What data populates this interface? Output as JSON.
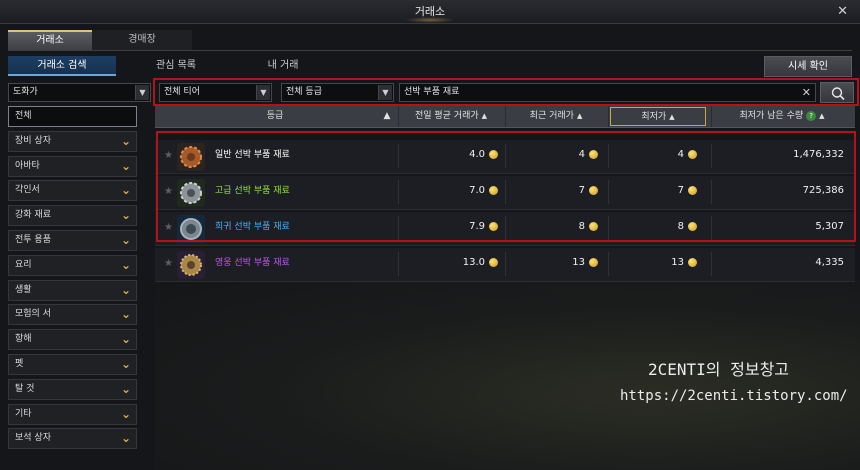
{
  "window": {
    "title": "거래소",
    "close_glyph": "✕"
  },
  "tabs": [
    {
      "label": "거래소"
    },
    {
      "label": "경매장"
    }
  ],
  "subtabs": [
    {
      "label": "거래소 검색"
    },
    {
      "label": "관심 목록"
    },
    {
      "label": "내 거래"
    }
  ],
  "market_button": "시세 확인",
  "filters": {
    "category": "도화가",
    "tier": "전체 티어",
    "grade": "전체 등급",
    "search_value": "선박 부품 재료",
    "clear_glyph": "✕"
  },
  "sidebar": {
    "items": [
      {
        "label": "전체",
        "expandable": false
      },
      {
        "label": "장비 상자",
        "expandable": true
      },
      {
        "label": "아바타",
        "expandable": true
      },
      {
        "label": "각인서",
        "expandable": true
      },
      {
        "label": "강화 재료",
        "expandable": true
      },
      {
        "label": "전투 용품",
        "expandable": true
      },
      {
        "label": "요리",
        "expandable": true
      },
      {
        "label": "생활",
        "expandable": true
      },
      {
        "label": "모험의 서",
        "expandable": true
      },
      {
        "label": "항해",
        "expandable": true
      },
      {
        "label": "펫",
        "expandable": true
      },
      {
        "label": "탈 것",
        "expandable": true
      },
      {
        "label": "기타",
        "expandable": true
      },
      {
        "label": "보석 상자",
        "expandable": true
      }
    ]
  },
  "table": {
    "headers": {
      "grade": "등급",
      "avg_price": "전일 평균 거래가",
      "recent_price": "최근 거래가",
      "lowest_price": "최저가",
      "lowest_qty": "최저가 남은 수량"
    },
    "help_glyph": "?",
    "sort_glyph": "▲",
    "rows": [
      {
        "name": "일반 선박 부품 재료",
        "name_color": "#ffffff",
        "avg": "4.0",
        "recent": "4",
        "lowest": "4",
        "qty": "1,476,332",
        "icon": "gear-bronze"
      },
      {
        "name": "고급 선박 부품 재료",
        "name_color": "#8fe13b",
        "avg": "7.0",
        "recent": "7",
        "lowest": "7",
        "qty": "725,386",
        "icon": "gear-silver"
      },
      {
        "name": "희귀 선박 부품 재료",
        "name_color": "#3fb4ff",
        "avg": "7.9",
        "recent": "8",
        "lowest": "8",
        "qty": "5,307",
        "icon": "gear-cog"
      },
      {
        "name": "영웅 선박 부품 재료",
        "name_color": "#c355ee",
        "avg": "13.0",
        "recent": "13",
        "lowest": "13",
        "qty": "4,335",
        "icon": "gear-gold"
      }
    ]
  },
  "watermark": {
    "line1": "2CENTI의 정보창고",
    "line2": "https://2centi.tistory.com/"
  },
  "colors": {
    "highlight_red": "#b3121a",
    "accent_gold": "#d0a442",
    "coin": "#e6b422"
  }
}
